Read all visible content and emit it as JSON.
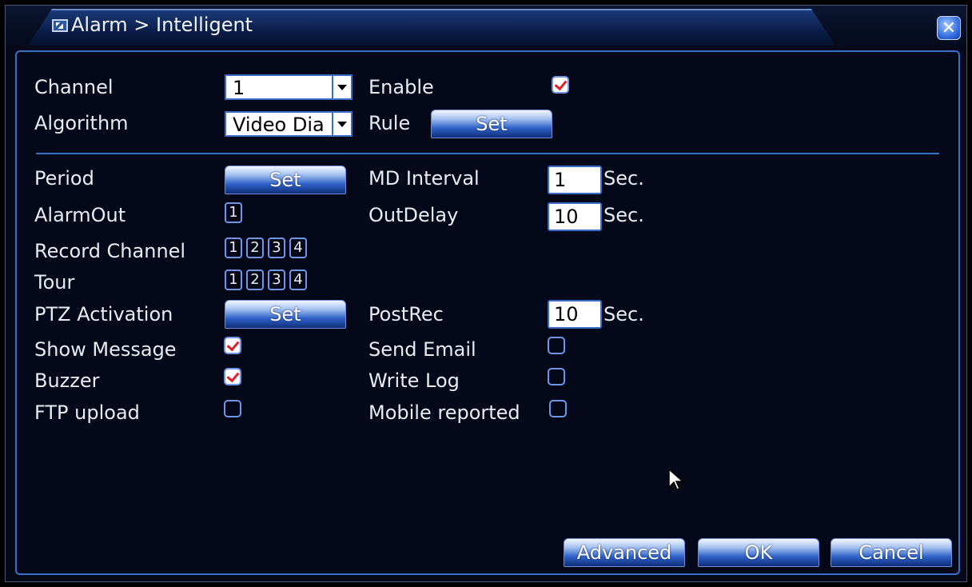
{
  "window": {
    "title": "Alarm > Intelligent",
    "close_icon": "close-icon"
  },
  "top": {
    "channel_label": "Channel",
    "channel_value": "1",
    "enable_label": "Enable",
    "enable_checked": true,
    "algorithm_label": "Algorithm",
    "algorithm_value": "Video Dia",
    "rule_label": "Rule",
    "rule_button": "Set"
  },
  "settings": {
    "period_label": "Period",
    "period_button": "Set",
    "md_interval_label": "MD Interval",
    "md_interval_value": "1",
    "alarmout_label": "AlarmOut",
    "alarmout_channels": [
      "1"
    ],
    "outdelay_label": "OutDelay",
    "outdelay_value": "10",
    "record_channel_label": "Record Channel",
    "record_channels": [
      "1",
      "2",
      "3",
      "4"
    ],
    "tour_label": "Tour",
    "tour_channels": [
      "1",
      "2",
      "3",
      "4"
    ],
    "ptz_label": "PTZ Activation",
    "ptz_button": "Set",
    "postrec_label": "PostRec",
    "postrec_value": "10",
    "sec_unit": "Sec.",
    "show_message_label": "Show Message",
    "show_message_checked": true,
    "send_email_label": "Send Email",
    "send_email_checked": false,
    "buzzer_label": "Buzzer",
    "buzzer_checked": true,
    "write_log_label": "Write Log",
    "write_log_checked": false,
    "ftp_upload_label": "FTP upload",
    "ftp_upload_checked": false,
    "mobile_reported_label": "Mobile reported",
    "mobile_reported_checked": false
  },
  "footer": {
    "advanced": "Advanced",
    "ok": "OK",
    "cancel": "Cancel"
  },
  "colors": {
    "background": "#06091a",
    "accent_border": "#3a6ec8",
    "check_mark": "#e0202a"
  }
}
